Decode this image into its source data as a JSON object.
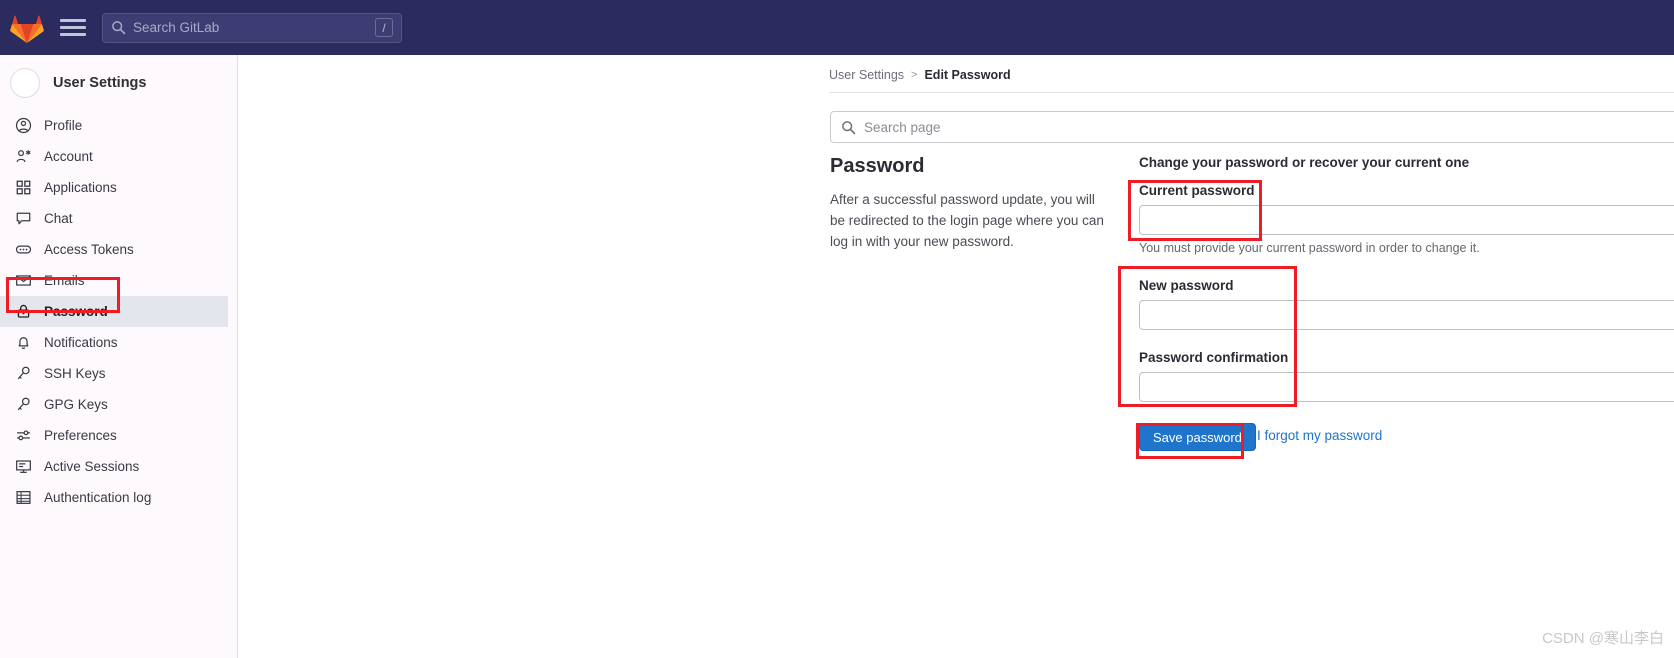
{
  "navbar": {
    "logo_icon": "gitlab-fox-logo",
    "menu_icon": "hamburger-menu-icon",
    "search_icon": "search-icon",
    "search_placeholder": "Search GitLab",
    "shortcut_key": "/"
  },
  "sidebar": {
    "title": "User Settings",
    "avatar": "user-avatar",
    "items": [
      {
        "label": "Profile",
        "icon": "user-circle-icon",
        "active": false
      },
      {
        "label": "Account",
        "icon": "account-icon",
        "active": false
      },
      {
        "label": "Applications",
        "icon": "applications-icon",
        "active": false
      },
      {
        "label": "Chat",
        "icon": "chat-bubble-icon",
        "active": false
      },
      {
        "label": "Access Tokens",
        "icon": "token-icon",
        "active": false
      },
      {
        "label": "Emails",
        "icon": "envelope-icon",
        "active": false
      },
      {
        "label": "Password",
        "icon": "lock-icon",
        "active": true
      },
      {
        "label": "Notifications",
        "icon": "bell-icon",
        "active": false
      },
      {
        "label": "SSH Keys",
        "icon": "key-icon",
        "active": false
      },
      {
        "label": "GPG Keys",
        "icon": "key-icon",
        "active": false
      },
      {
        "label": "Preferences",
        "icon": "sliders-icon",
        "active": false
      },
      {
        "label": "Active Sessions",
        "icon": "monitor-icon",
        "active": false
      },
      {
        "label": "Authentication log",
        "icon": "list-grid-icon",
        "active": false
      }
    ]
  },
  "breadcrumb": {
    "parent": "User Settings",
    "separator": ">",
    "current": "Edit Password"
  },
  "page_search": {
    "icon": "search-icon",
    "placeholder": "Search page",
    "value": ""
  },
  "section": {
    "title": "Password",
    "description": "After a successful password update, you will be redirected to the login page where you can log in with your new password."
  },
  "form": {
    "heading": "Change your password or recover your current one",
    "current_password": {
      "label": "Current password",
      "value": "",
      "help": "You must provide your current password in order to change it."
    },
    "new_password": {
      "label": "New password",
      "value": ""
    },
    "password_confirmation": {
      "label": "Password confirmation",
      "value": ""
    },
    "save_button": "Save password",
    "forgot_link": "I forgot my password"
  },
  "annotations": [
    {
      "name": "sidebar-password-highlight",
      "color": "#ee1c25"
    },
    {
      "name": "current-password-highlight",
      "color": "#ee1c25"
    },
    {
      "name": "new-password-confirm-highlight",
      "color": "#ee1c25"
    },
    {
      "name": "save-password-highlight",
      "color": "#ee1c25"
    }
  ],
  "watermark": "CSDN @寒山李白",
  "colors": {
    "navbar_bg": "#2b2b5f",
    "sidebar_bg": "#fdf9fd",
    "active_item_bg": "#e4e6ee",
    "primary_button": "#1f75cb",
    "link": "#1f75cb",
    "annotation": "#ee1c25"
  }
}
